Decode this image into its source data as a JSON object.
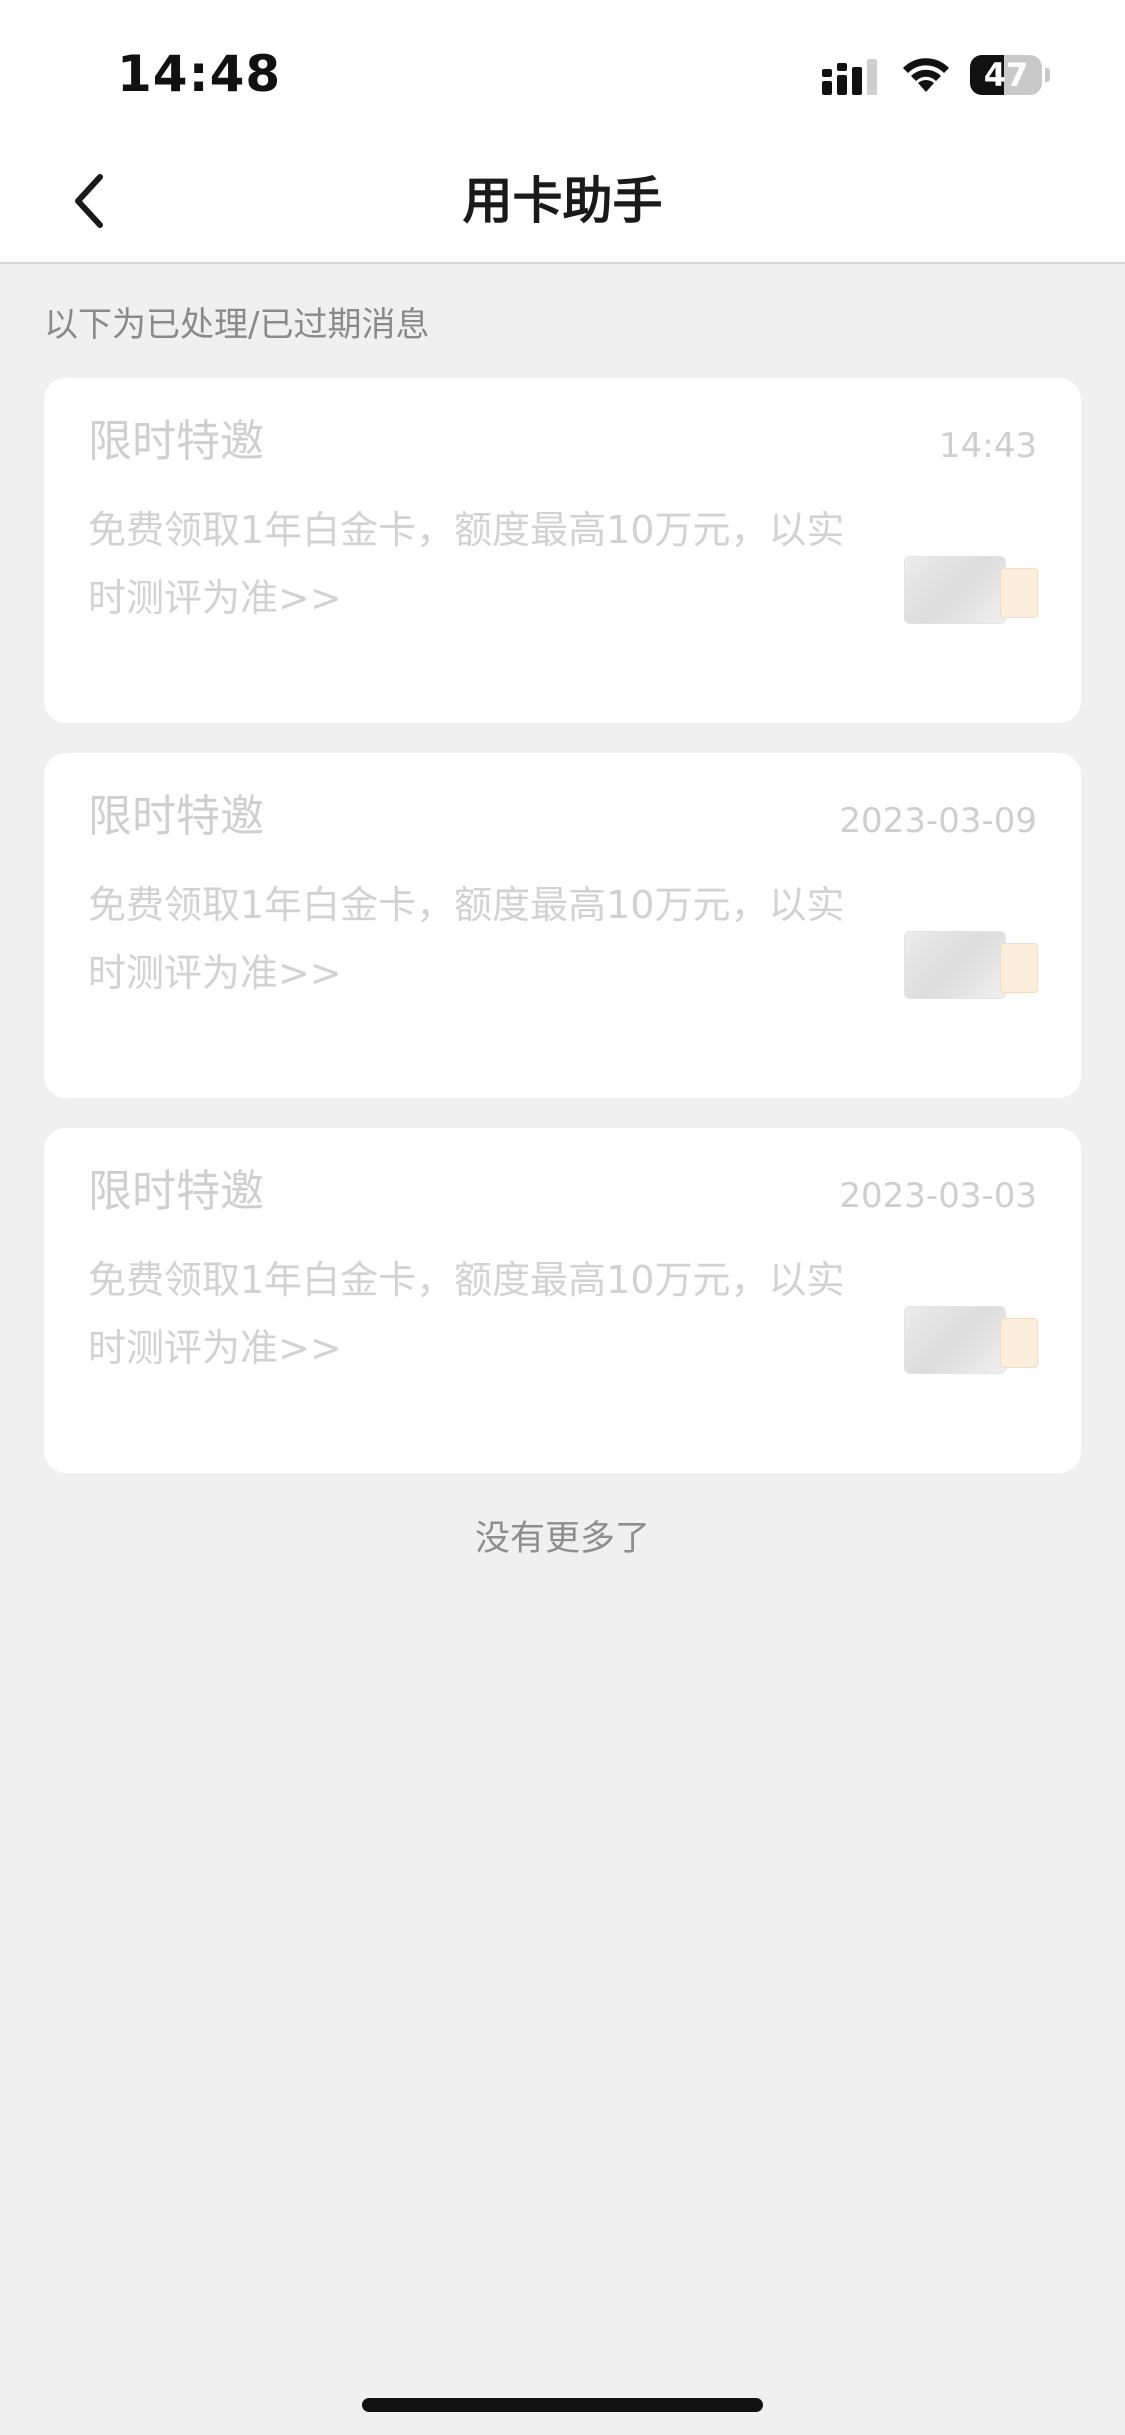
{
  "status_bar": {
    "time": "14:48",
    "battery_level": "47"
  },
  "nav": {
    "title": "用卡助手"
  },
  "hint": "以下为已处理/已过期消息",
  "messages": [
    {
      "title": "限时特邀",
      "time": "14:43",
      "body": "免费领取1年白金卡，额度最高10万元，以实时测评为准>>"
    },
    {
      "title": "限时特邀",
      "time": "2023-03-09",
      "body": "免费领取1年白金卡，额度最高10万元，以实时测评为准>>"
    },
    {
      "title": "限时特邀",
      "time": "2023-03-03",
      "body": "免费领取1年白金卡，额度最高10万元，以实时测评为准>>"
    }
  ],
  "footer": {
    "no_more": "没有更多了"
  },
  "colors": {
    "background": "#f0f0f0",
    "card": "#ffffff",
    "faded_text": "#cfcfcf",
    "hint_text": "#8a8a8a"
  },
  "icons": {
    "back": "chevron-left-icon",
    "signal": "cellular-signal-icon",
    "wifi": "wifi-icon",
    "battery": "battery-icon"
  }
}
